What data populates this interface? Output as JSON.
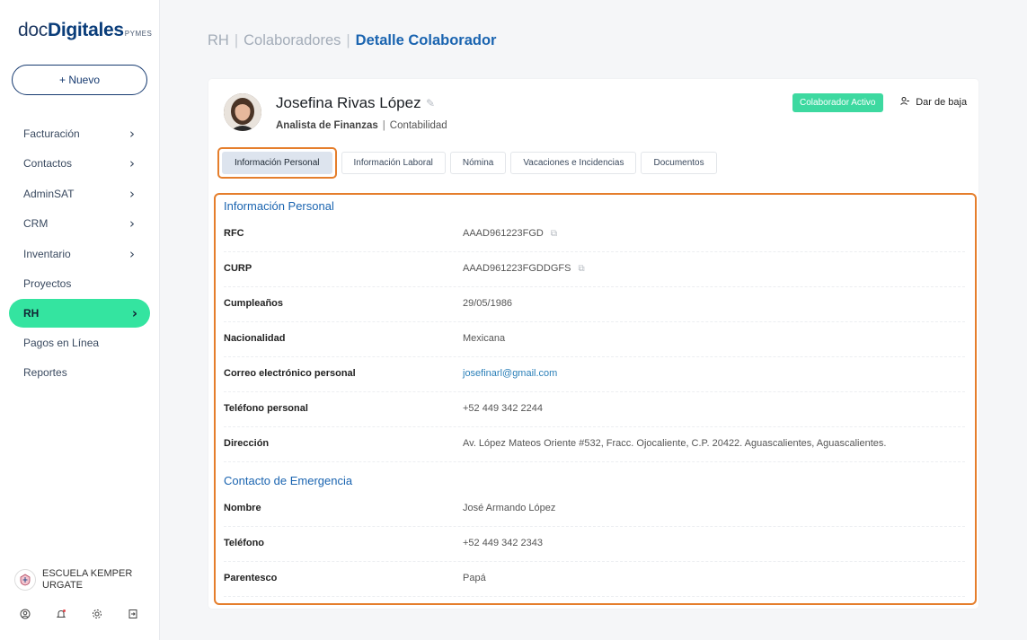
{
  "brand": {
    "doc": "doc",
    "digitales": "Digitales",
    "pymes": "PYMES"
  },
  "sidebar": {
    "new_button": "+ Nuevo",
    "items": [
      {
        "label": "Facturación",
        "chevron": true
      },
      {
        "label": "Contactos",
        "chevron": true
      },
      {
        "label": "AdminSAT",
        "chevron": true
      },
      {
        "label": "CRM",
        "chevron": true
      },
      {
        "label": "Inventario",
        "chevron": true
      },
      {
        "label": "Proyectos",
        "chevron": false
      },
      {
        "label": "RH",
        "chevron": true,
        "active": true
      },
      {
        "label": "Pagos en Línea",
        "chevron": false
      },
      {
        "label": "Reportes",
        "chevron": false
      }
    ],
    "org_name": "ESCUELA KEMPER URGATE",
    "bottom_icons": [
      "user-icon",
      "bell-icon",
      "gear-icon",
      "logout-icon"
    ]
  },
  "breadcrumb": {
    "level1": "RH",
    "level2": "Colaboradores",
    "current": "Detalle Colaborador"
  },
  "employee": {
    "name": "Josefina Rivas López",
    "role": "Analista de Finanzas",
    "department": "Contabilidad",
    "status": "Colaborador Activo",
    "dismiss_label": "Dar de baja"
  },
  "tabs": [
    "Información Personal",
    "Información Laboral",
    "Nómina",
    "Vacaciones e Incidencias",
    "Documentos"
  ],
  "personal": {
    "title": "Información Personal",
    "rfc_label": "RFC",
    "rfc": "AAAD961223FGD",
    "curp_label": "CURP",
    "curp": "AAAD961223FGDDGFS",
    "birthday_label": "Cumpleaños",
    "birthday": "29/05/1986",
    "nationality_label": "Nacionalidad",
    "nationality": "Mexicana",
    "email_label": "Correo electrónico personal",
    "email": "josefinarl@gmail.com",
    "phone_label": "Teléfono personal",
    "phone": "+52 449 342 2244",
    "address_label": "Dirección",
    "address": "Av. López Mateos Oriente #532, Fracc. Ojocaliente, C.P. 20422. Aguascalientes, Aguascalientes."
  },
  "emergency": {
    "title": "Contacto de Emergencia",
    "name_label": "Nombre",
    "name": "José Armando López",
    "phone_label": "Teléfono",
    "phone": "+52 449 342 2343",
    "relation_label": "Parentesco",
    "relation": "Papá"
  },
  "colors": {
    "accent": "#1a64b0",
    "active_nav": "#34e4a0",
    "badge": "#3dd9a0",
    "highlight": "#e57e2c"
  }
}
